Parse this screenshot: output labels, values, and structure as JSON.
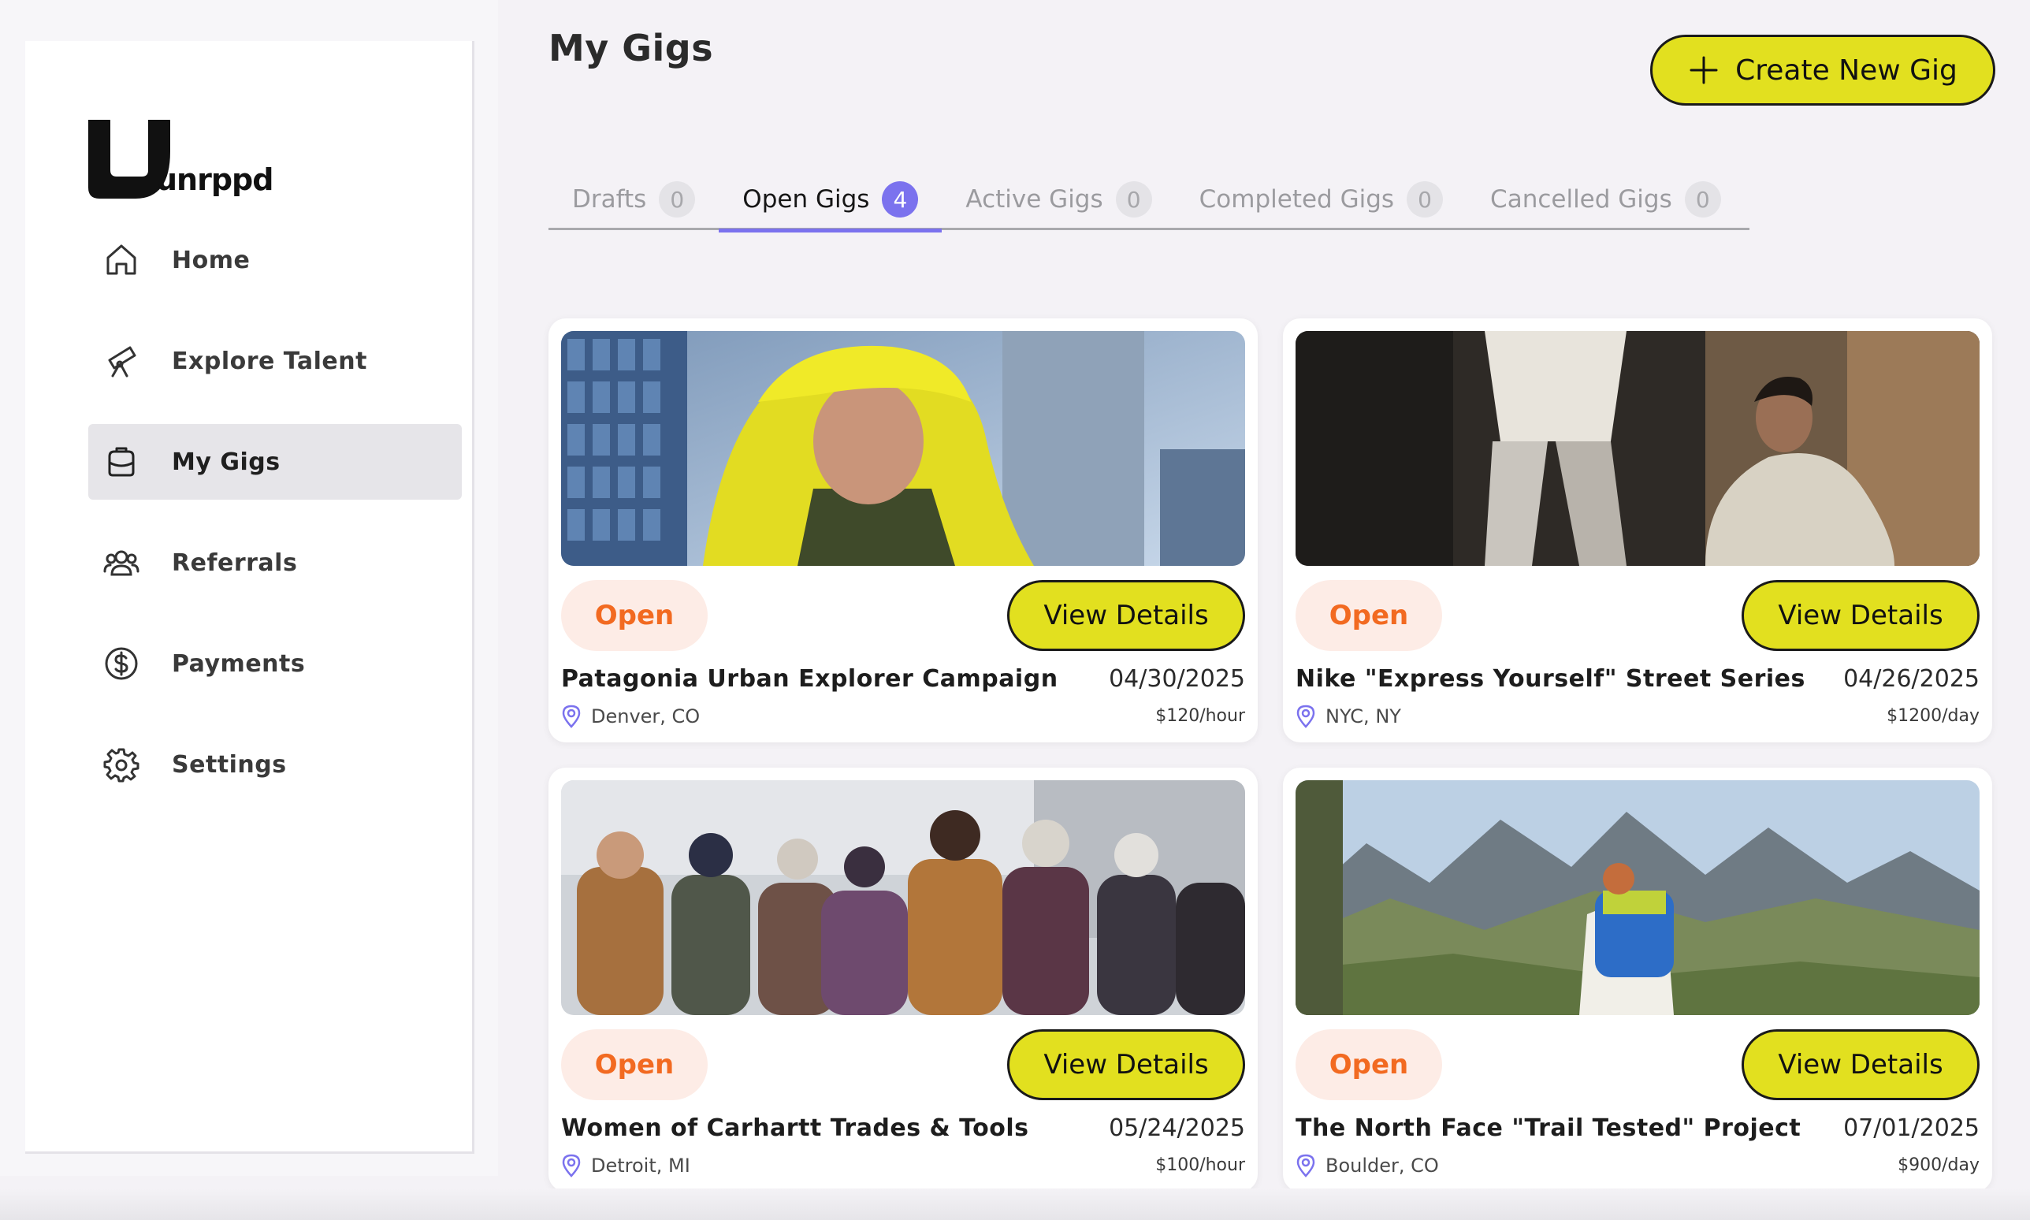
{
  "brand": {
    "name": "unrppd"
  },
  "sidebar": {
    "items": [
      {
        "label": "Home",
        "icon": "home-icon"
      },
      {
        "label": "Explore Talent",
        "icon": "telescope-icon"
      },
      {
        "label": "My Gigs",
        "icon": "briefcase-icon",
        "active": true
      },
      {
        "label": "Referrals",
        "icon": "users-icon"
      },
      {
        "label": "Payments",
        "icon": "dollar-circle-icon"
      },
      {
        "label": "Settings",
        "icon": "gear-icon"
      }
    ]
  },
  "header": {
    "title": "My Gigs",
    "create_button": "Create New Gig"
  },
  "tabs": [
    {
      "label": "Drafts",
      "count": "0"
    },
    {
      "label": "Open Gigs",
      "count": "4",
      "active": true
    },
    {
      "label": "Active Gigs",
      "count": "0"
    },
    {
      "label": "Completed Gigs",
      "count": "0"
    },
    {
      "label": "Cancelled Gigs",
      "count": "0"
    }
  ],
  "gigs": [
    {
      "status": "Open",
      "action": "View Details",
      "title": "Patagonia Urban Explorer Campaign",
      "date": "04/30/2025",
      "location": "Denver, CO",
      "rate": "$120/hour",
      "image": "model-yellow-hood-city-photo"
    },
    {
      "status": "Open",
      "action": "View Details",
      "title": "Nike \"Express Yourself\" Street Series",
      "date": "04/26/2025",
      "location": "NYC, NY",
      "rate": "$1200/day",
      "image": "street-fashion-photo"
    },
    {
      "status": "Open",
      "action": "View Details",
      "title": "Women of Carhartt Trades & Tools",
      "date": "05/24/2025",
      "location": "Detroit, MI",
      "rate": "$100/hour",
      "image": "group-winter-workwear-photo"
    },
    {
      "status": "Open",
      "action": "View Details",
      "title": "The North Face \"Trail Tested\" Project",
      "date": "07/01/2025",
      "location": "Boulder, CO",
      "rate": "$900/day",
      "image": "mountain-hiker-photo"
    }
  ],
  "colors": {
    "accent_yellow": "#e2e01f",
    "tab_active": "#7b72ee",
    "open_badge_text": "#f26a21",
    "open_badge_bg": "#fdece6"
  }
}
